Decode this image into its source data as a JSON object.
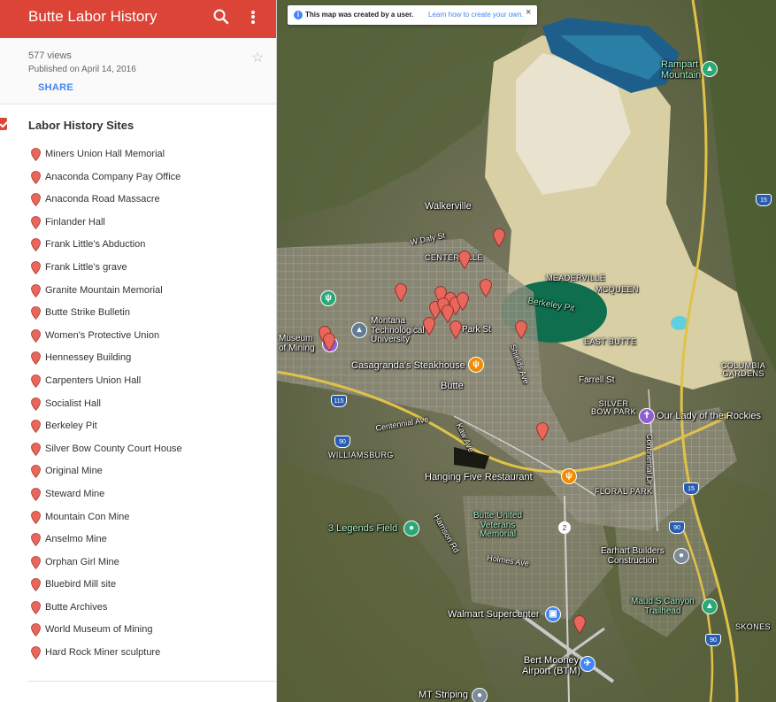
{
  "map": {
    "title": "Butte Labor History",
    "views": "577 views",
    "published": "Published on April 14, 2016",
    "share_label": "SHARE"
  },
  "layer": {
    "title": "Labor History Sites",
    "color": "#db4437",
    "items": [
      "Miners Union Hall Memorial",
      "Anaconda Company Pay Office",
      "Anaconda Road Massacre",
      "Finlander Hall",
      "Frank Little's Abduction",
      "Frank Little's grave",
      "Granite Mountain Memorial",
      "Butte Strike Bulletin",
      "Women's Protective Union",
      "Hennessey Building",
      "Carpenters Union Hall",
      "Socialist Hall",
      "Berkeley Pit",
      "Silver Bow County Court House",
      "Original Mine",
      "Steward Mine",
      "Mountain Con Mine",
      "Anselmo Mine",
      "Orphan Girl Mine",
      "Bluebird Mill site",
      "Butte Archives",
      "World Museum of Mining",
      "Hard Rock Miner sculpture"
    ]
  },
  "banner": {
    "text": "This map was created by a user.",
    "link": "Learn how to create your own."
  },
  "basemap_labels": {
    "rampart": "Rampart\nMountain",
    "walkerville": "Walkerville",
    "w_daly": "W Daly St",
    "centerville": "CENTERVILLE",
    "meaderville": "MEADERVILLE",
    "mcqueen": "MCQUEEN",
    "berkeley_pit": "Berkeley Pit",
    "east_butte": "EAST BUTTE",
    "montana_tech": "Montana\nTechnological\nUniversity",
    "museum": "Museum\nof Mining",
    "park_st": "Park St",
    "shields_ave": "Shields Ave",
    "casagranda": "Casagranda's Steakhouse",
    "butte": "Butte",
    "farrell": "Farrell St",
    "silver_bow_park": "SILVER\nBOW PARK",
    "our_lady": "Our Lady of the Rockies",
    "columbia_gardens": "COLUMBIA\nGARDENS",
    "centennial": "Centennial Ave",
    "kaw_ave": "Kaw Ave",
    "williamsburg": "WILLIAMSBURG",
    "continental": "Continental Dr",
    "hanging_five": "Hanging Five Restaurant",
    "floral_park": "FLORAL PARK",
    "legends_field": "3 Legends Field",
    "harrison": "Harrison Rd",
    "veterans": "Butte United\nVeterans\nMemorial",
    "holmes": "Holmes Ave",
    "earhart": "Earhart Builders\nConstruction",
    "maud": "Maud S Canyon\nTrailhead",
    "walmart": "Walmart Supercenter",
    "skones": "SKONES",
    "bert_mooney": "Bert Mooney\nAirport (BTM)",
    "mt_striping": "MT Striping"
  },
  "route_shields": {
    "i15_a": "15",
    "i15_b": "15",
    "i115": "115",
    "i90_a": "90",
    "i90_b": "90",
    "i90_c": "90",
    "i15_c": "15",
    "sr2": "2"
  },
  "icons": {
    "menu": "menu-icon",
    "search": "search-icon",
    "more": "more-vert-icon",
    "star": "star-icon",
    "pin": "map-pin-icon"
  },
  "colors": {
    "header": "#db4437",
    "pin": "#e8675c",
    "link": "#4285f4"
  }
}
